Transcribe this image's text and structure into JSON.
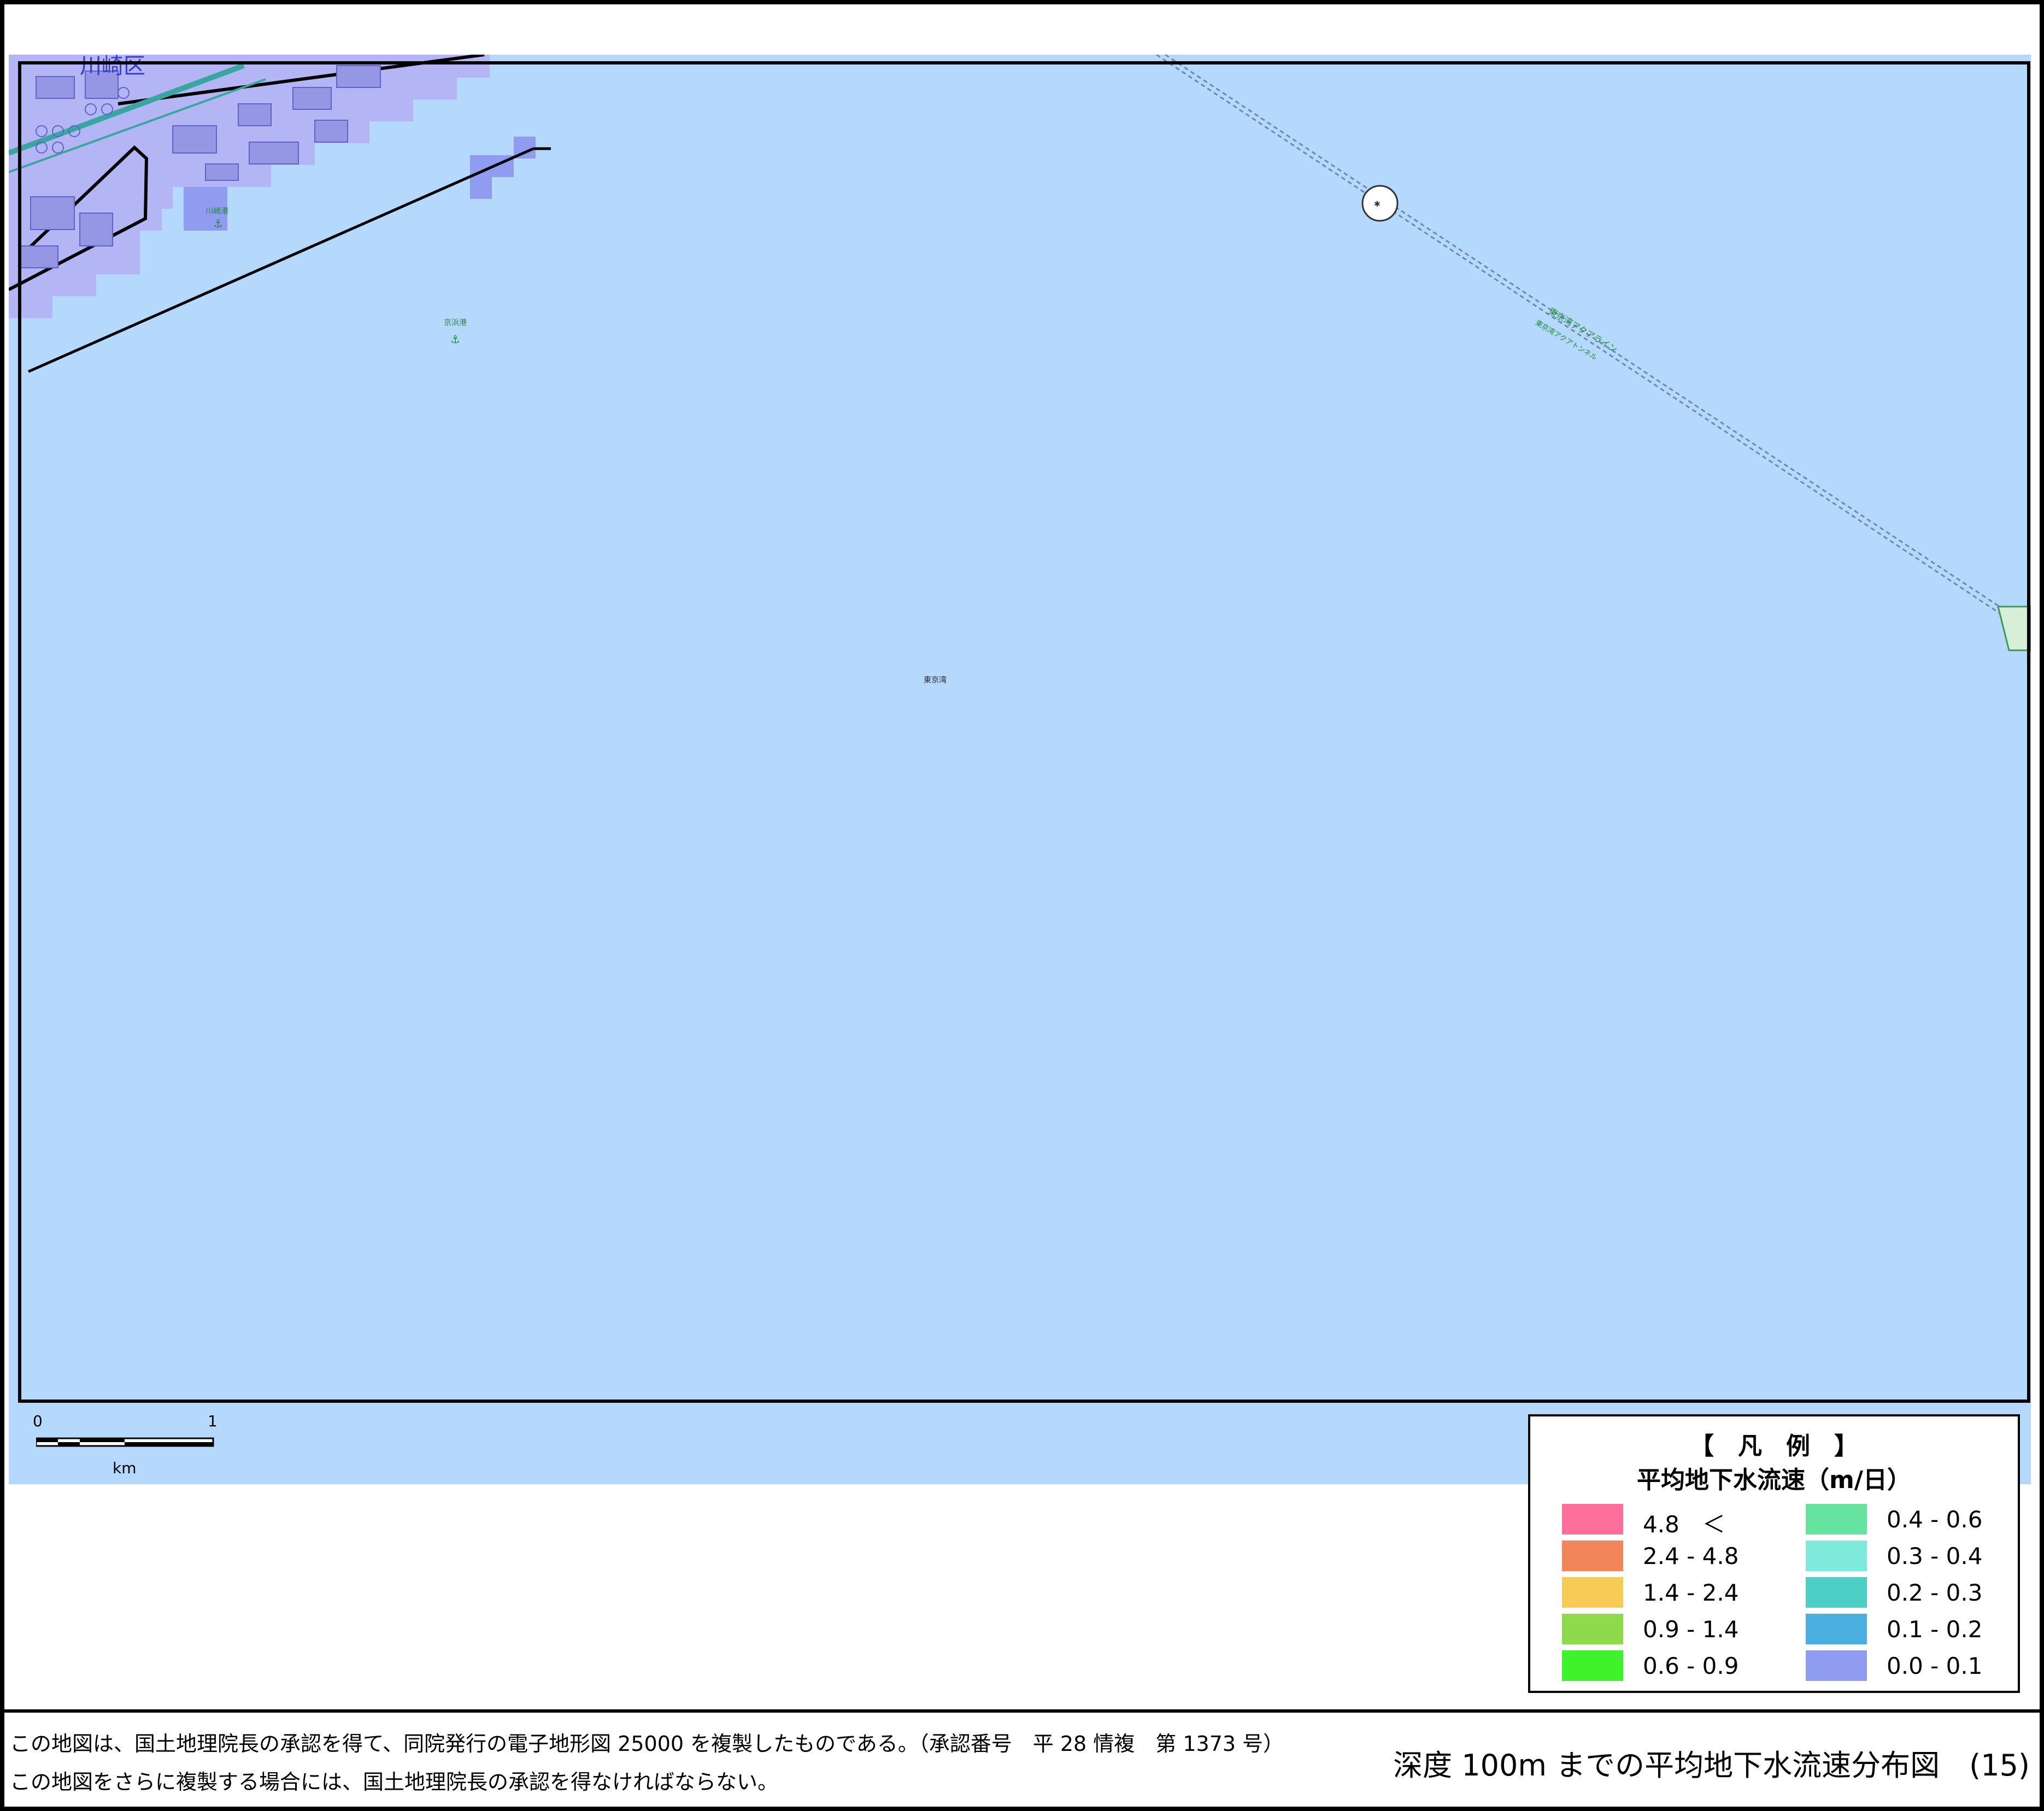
{
  "map": {
    "district_label": "川崎区",
    "sea_label": "東京湾",
    "port_labels": [
      "川崎港",
      "京浜港"
    ],
    "route_labels": [
      "東京湾アクアライン",
      "東京湾アクアトンネル"
    ],
    "colors": {
      "sea": "#b5d8fd",
      "land_overlay": "#b7b8f5",
      "velocity_cell": "#8f9cf0",
      "frame": "#000000"
    },
    "icons": [
      "anchor-icon",
      "ventilation-tower-icon"
    ]
  },
  "scale_bar": {
    "min_label": "0",
    "max_label": "1",
    "unit_label": "km"
  },
  "legend": {
    "title": "【　凡　例　】",
    "subtitle": "平均地下水流速（m/日）",
    "items": [
      {
        "label": "4.8　＜",
        "color": "#ff6f9c"
      },
      {
        "label": "2.4 - 4.8",
        "color": "#f2855a"
      },
      {
        "label": "1.4 - 2.4",
        "color": "#f6cc56"
      },
      {
        "label": "0.9 - 1.4",
        "color": "#8ed94e"
      },
      {
        "label": "0.6 - 0.9",
        "color": "#3ef22c"
      },
      {
        "label": "0.4 - 0.6",
        "color": "#66e39e"
      },
      {
        "label": "0.3 - 0.4",
        "color": "#7eeadb"
      },
      {
        "label": "0.2 - 0.3",
        "color": "#4ecfc5"
      },
      {
        "label": "0.1 - 0.2",
        "color": "#4aaedf"
      },
      {
        "label": "0.0 - 0.1",
        "color": "#8f9cf0"
      }
    ]
  },
  "footer": {
    "note_1": "この地図は、国土地理院長の承認を得て、同院発行の電子地形図 25000 を複製したものである。（承認番号　平 28 情複　第 1373 号）",
    "note_2": "この地図をさらに複製する場合には、国土地理院長の承認を得なければならない。",
    "title": "深度 100m までの平均地下水流速分布図　(15)"
  }
}
